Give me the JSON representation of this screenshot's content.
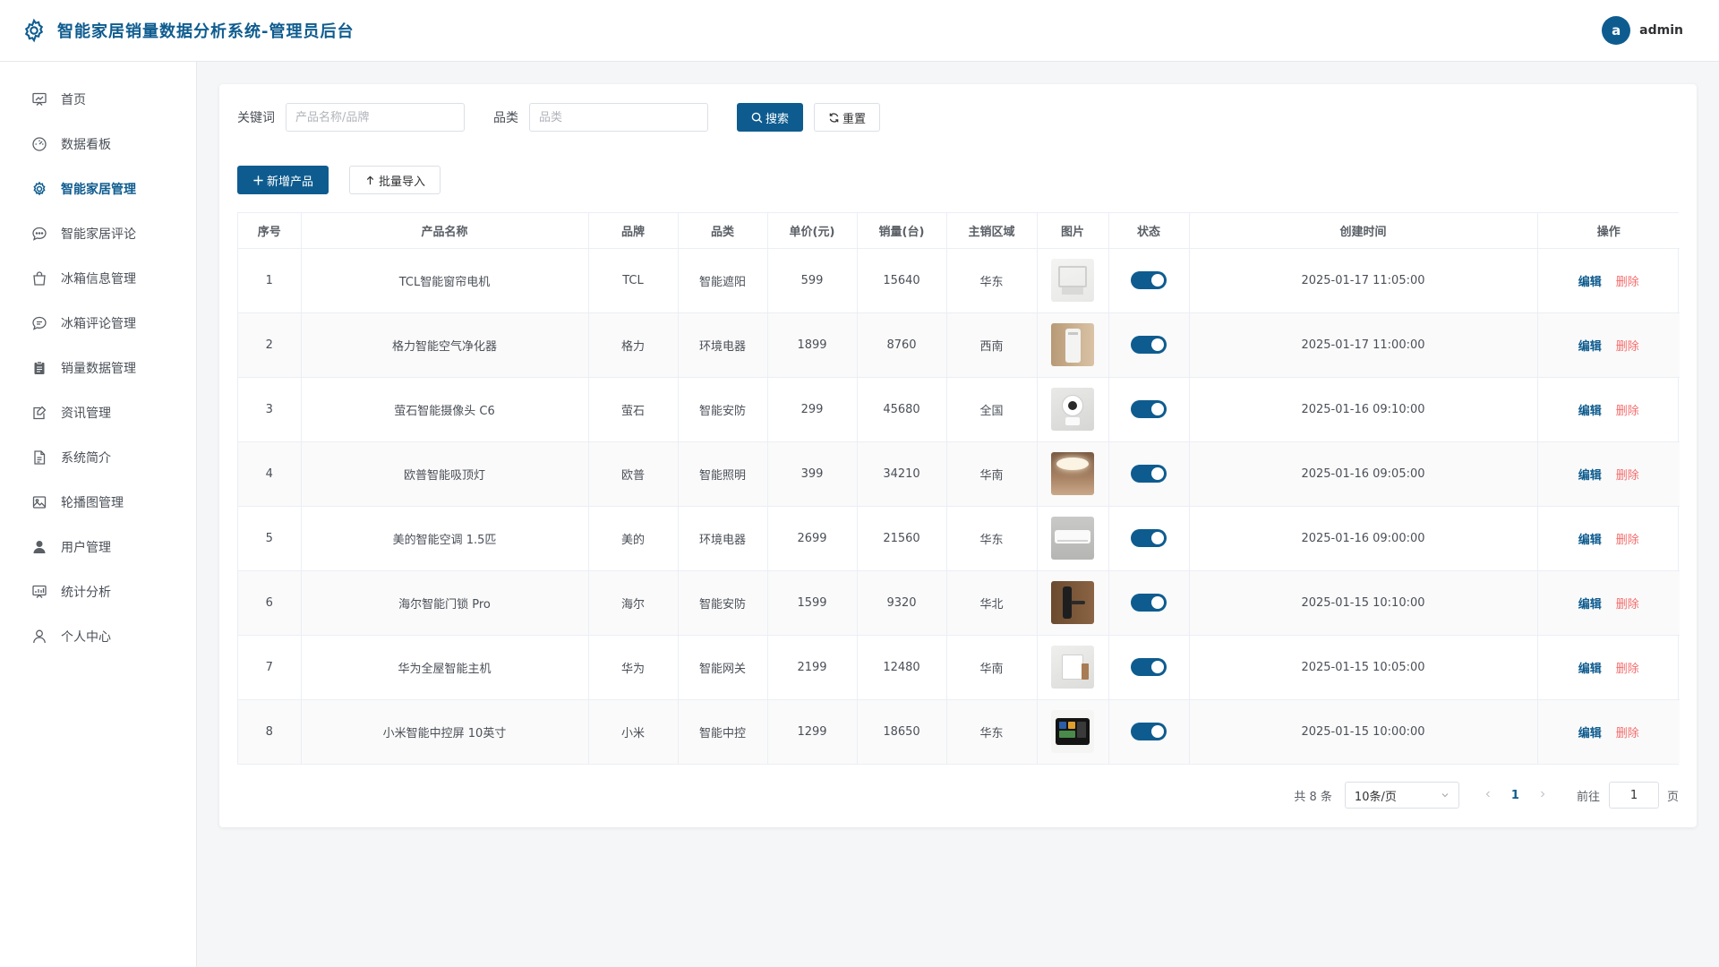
{
  "header": {
    "title": "智能家居销量数据分析系统-管理员后台",
    "avatar_letter": "a",
    "username": "admin"
  },
  "sidebar": {
    "items": [
      {
        "label": "首页",
        "icon": "presentation-icon"
      },
      {
        "label": "数据看板",
        "icon": "gauge-icon"
      },
      {
        "label": "智能家居管理",
        "icon": "gear-icon",
        "active": true
      },
      {
        "label": "智能家居评论",
        "icon": "chat-dots-icon"
      },
      {
        "label": "冰箱信息管理",
        "icon": "shopping-bag-icon"
      },
      {
        "label": "冰箱评论管理",
        "icon": "chat-line-icon"
      },
      {
        "label": "销量数据管理",
        "icon": "clipboard-icon"
      },
      {
        "label": "资讯管理",
        "icon": "news-icon"
      },
      {
        "label": "系统简介",
        "icon": "document-icon"
      },
      {
        "label": "轮播图管理",
        "icon": "picture-icon"
      },
      {
        "label": "用户管理",
        "icon": "user-filled-icon"
      },
      {
        "label": "统计分析",
        "icon": "chart-board-icon"
      },
      {
        "label": "个人中心",
        "icon": "user-outline-icon"
      }
    ]
  },
  "filters": {
    "keyword_label": "关键词",
    "keyword_placeholder": "产品名称/品牌",
    "keyword_value": "",
    "category_label": "品类",
    "category_placeholder": "品类",
    "category_value": "",
    "search_label": "搜索",
    "reset_label": "重置"
  },
  "actions": {
    "add_label": "新增产品",
    "import_label": "批量导入"
  },
  "table": {
    "columns": [
      "序号",
      "产品名称",
      "品牌",
      "品类",
      "单价(元)",
      "销量(台)",
      "主销区域",
      "图片",
      "状态",
      "创建时间",
      "操作"
    ],
    "edit_label": "编辑",
    "delete_label": "删除",
    "rows": [
      {
        "idx": "1",
        "name": "TCL智能窗帘电机",
        "brand": "TCL",
        "category": "智能遮阳",
        "price": "599",
        "sales": "15640",
        "region": "华东",
        "image": "curtain-motor",
        "status": true,
        "created": "2025-01-17 11:05:00"
      },
      {
        "idx": "2",
        "name": "格力智能空气净化器",
        "brand": "格力",
        "category": "环境电器",
        "price": "1899",
        "sales": "8760",
        "region": "西南",
        "image": "air-purifier",
        "status": true,
        "created": "2025-01-17 11:00:00"
      },
      {
        "idx": "3",
        "name": "萤石智能摄像头 C6",
        "brand": "萤石",
        "category": "智能安防",
        "price": "299",
        "sales": "45680",
        "region": "全国",
        "image": "camera",
        "status": true,
        "created": "2025-01-16 09:10:00"
      },
      {
        "idx": "4",
        "name": "欧普智能吸顶灯",
        "brand": "欧普",
        "category": "智能照明",
        "price": "399",
        "sales": "34210",
        "region": "华南",
        "image": "ceiling-light",
        "status": true,
        "created": "2025-01-16 09:05:00"
      },
      {
        "idx": "5",
        "name": "美的智能空调 1.5匹",
        "brand": "美的",
        "category": "环境电器",
        "price": "2699",
        "sales": "21560",
        "region": "华东",
        "image": "air-conditioner",
        "status": true,
        "created": "2025-01-16 09:00:00"
      },
      {
        "idx": "6",
        "name": "海尔智能门锁 Pro",
        "brand": "海尔",
        "category": "智能安防",
        "price": "1599",
        "sales": "9320",
        "region": "华北",
        "image": "door-lock",
        "status": true,
        "created": "2025-01-15 10:10:00"
      },
      {
        "idx": "7",
        "name": "华为全屋智能主机",
        "brand": "华为",
        "category": "智能网关",
        "price": "2199",
        "sales": "12480",
        "region": "华南",
        "image": "smart-host",
        "status": true,
        "created": "2025-01-15 10:05:00"
      },
      {
        "idx": "8",
        "name": "小米智能中控屏 10英寸",
        "brand": "小米",
        "category": "智能中控",
        "price": "1299",
        "sales": "18650",
        "region": "华东",
        "image": "control-screen",
        "status": true,
        "created": "2025-01-15 10:00:00"
      }
    ]
  },
  "pagination": {
    "total_text": "共 8 条",
    "page_size": "10条/页",
    "current_page": "1",
    "goto_label": "前往",
    "goto_value": "1",
    "page_suffix": "页"
  },
  "colors": {
    "primary": "#0e5c8f",
    "danger": "#f56c6c"
  }
}
